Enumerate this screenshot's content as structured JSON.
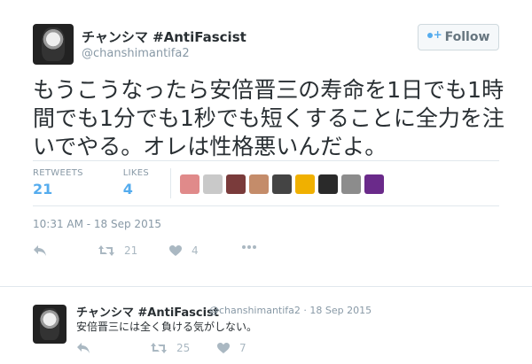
{
  "tweet": {
    "display_name": "チャンシマ #AntiFascist",
    "handle": "@chanshimantifa2",
    "follow_label": "Follow",
    "text": "もうこうなったら安倍晋三の寿命を1日でも1時間でも1分でも1秒でも短くすることに全力を注いでやる。オレは性格悪いんだよ。",
    "retweets_label": "RETWEETS",
    "retweets_count": "21",
    "likes_label": "LIKES",
    "likes_count": "4",
    "timestamp": "10:31 AM - 18 Sep 2015",
    "action_retweet_count": "21",
    "action_like_count": "4",
    "liker_colors": [
      "#e08a8a",
      "#c9c9c9",
      "#7a3b3b",
      "#c48c6a",
      "#444444",
      "#f0b000",
      "#2a2a2a",
      "#8c8c8c",
      "#6a2a8a"
    ]
  },
  "reply": {
    "display_name": "チャンシマ #AntiFascist",
    "handle_date": "@chanshimantifa2 · 18 Sep 2015",
    "text": "安倍晋三には全く負ける気がしない。",
    "retweet_count": "25",
    "like_count": "7"
  },
  "colors": {
    "link_blue": "#55acee",
    "muted": "#8899a6",
    "icon_gray": "#aab8c2"
  },
  "icons": [
    "follow-person-icon",
    "reply-icon",
    "retweet-icon",
    "heart-icon",
    "more-icon"
  ]
}
